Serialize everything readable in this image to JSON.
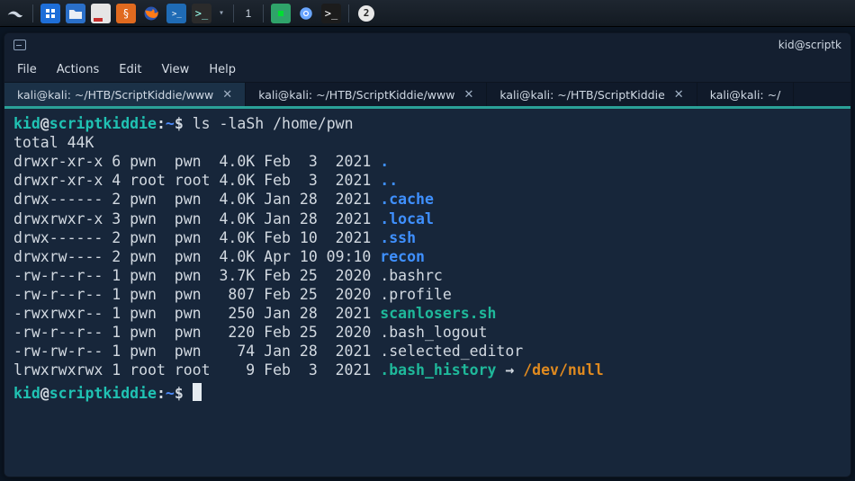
{
  "taskbar": {
    "workspace_number": "1",
    "badge_value": "2"
  },
  "window": {
    "title_right": "kid@scriptk",
    "title_icon": "terminal-icon"
  },
  "menu": {
    "items": [
      "File",
      "Actions",
      "Edit",
      "View",
      "Help"
    ]
  },
  "tabs": [
    {
      "label": "kali@kali: ~/HTB/ScriptKiddie/www",
      "active": true,
      "closable": true
    },
    {
      "label": "kali@kali: ~/HTB/ScriptKiddie/www",
      "active": false,
      "closable": true
    },
    {
      "label": "kali@kali: ~/HTB/ScriptKiddie",
      "active": false,
      "closable": true
    },
    {
      "label": "kali@kali: ~/",
      "active": false,
      "closable": false
    }
  ],
  "prompt": {
    "user": "kid",
    "at": "@",
    "host": "scriptkiddie",
    "colon": ":",
    "path": "~",
    "sigil": "$"
  },
  "command": "ls -laSh /home/pwn",
  "total_line": "total 44K",
  "listing": [
    {
      "perm": "drwxr-xr-x",
      "links": "6",
      "own": "pwn ",
      "grp": "pwn ",
      "size": "4.0K",
      "mon": "Feb",
      "day": " 3",
      "time": " 2021",
      "name": ".",
      "cls": "dirc"
    },
    {
      "perm": "drwxr-xr-x",
      "links": "4",
      "own": "root",
      "grp": "root",
      "size": "4.0K",
      "mon": "Feb",
      "day": " 3",
      "time": " 2021",
      "name": "..",
      "cls": "dirc"
    },
    {
      "perm": "drwx------",
      "links": "2",
      "own": "pwn ",
      "grp": "pwn ",
      "size": "4.0K",
      "mon": "Jan",
      "day": "28",
      "time": " 2021",
      "name": ".cache",
      "cls": "dirc"
    },
    {
      "perm": "drwxrwxr-x",
      "links": "3",
      "own": "pwn ",
      "grp": "pwn ",
      "size": "4.0K",
      "mon": "Jan",
      "day": "28",
      "time": " 2021",
      "name": ".local",
      "cls": "dirc"
    },
    {
      "perm": "drwx------",
      "links": "2",
      "own": "pwn ",
      "grp": "pwn ",
      "size": "4.0K",
      "mon": "Feb",
      "day": "10",
      "time": " 2021",
      "name": ".ssh",
      "cls": "dirc"
    },
    {
      "perm": "drwxrw----",
      "links": "2",
      "own": "pwn ",
      "grp": "pwn ",
      "size": "4.0K",
      "mon": "Apr",
      "day": "10",
      "time": "09:10",
      "name": "recon",
      "cls": "dirc"
    },
    {
      "perm": "-rw-r--r--",
      "links": "1",
      "own": "pwn ",
      "grp": "pwn ",
      "size": "3.7K",
      "mon": "Feb",
      "day": "25",
      "time": " 2020",
      "name": ".bashrc",
      "cls": ""
    },
    {
      "perm": "-rw-r--r--",
      "links": "1",
      "own": "pwn ",
      "grp": "pwn ",
      "size": " 807",
      "mon": "Feb",
      "day": "25",
      "time": " 2020",
      "name": ".profile",
      "cls": ""
    },
    {
      "perm": "-rwxrwxr--",
      "links": "1",
      "own": "pwn ",
      "grp": "pwn ",
      "size": " 250",
      "mon": "Jan",
      "day": "28",
      "time": " 2021",
      "name": "scanlosers.sh",
      "cls": "execc"
    },
    {
      "perm": "-rw-r--r--",
      "links": "1",
      "own": "pwn ",
      "grp": "pwn ",
      "size": " 220",
      "mon": "Feb",
      "day": "25",
      "time": " 2020",
      "name": ".bash_logout",
      "cls": ""
    },
    {
      "perm": "-rw-rw-r--",
      "links": "1",
      "own": "pwn ",
      "grp": "pwn ",
      "size": "  74",
      "mon": "Jan",
      "day": "28",
      "time": " 2021",
      "name": ".selected_editor",
      "cls": ""
    },
    {
      "perm": "lrwxrwxrwx",
      "links": "1",
      "own": "root",
      "grp": "root",
      "size": "   9",
      "mon": "Feb",
      "day": " 3",
      "time": " 2021",
      "name": ".bash_history",
      "cls": "linkc",
      "arrow": "→",
      "target": "/dev/null"
    }
  ]
}
